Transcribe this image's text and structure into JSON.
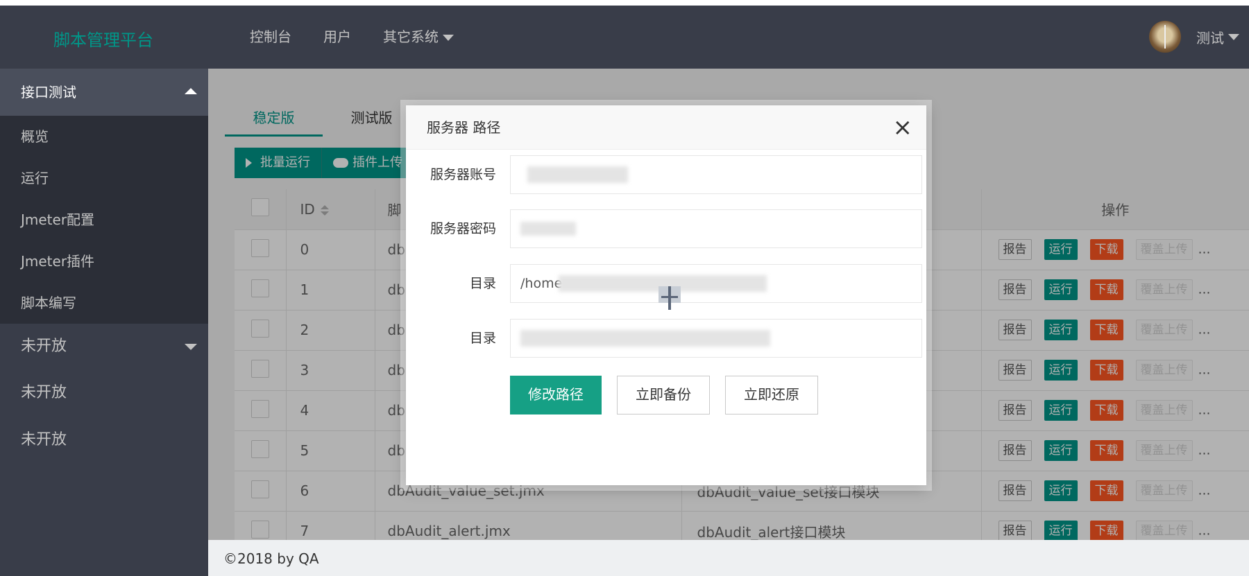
{
  "header": {
    "logo": "脚本管理平台",
    "nav": [
      "控制台",
      "用户",
      "其它系统"
    ],
    "user_name": "测试"
  },
  "sidebar": {
    "group_title": "接口测试",
    "items": [
      "概览",
      "运行",
      "Jmeter配置",
      "Jmeter插件",
      "脚本编写"
    ],
    "group2_title": "未开放",
    "plain_items": [
      "未开放",
      "未开放"
    ]
  },
  "tabs": [
    "稳定版",
    "测试版"
  ],
  "toolbar": {
    "batch_run": "批量运行",
    "plugin_upload": "插件上传"
  },
  "table": {
    "headers": {
      "id": "ID",
      "script": "脚",
      "ops": "操作"
    },
    "rows": [
      {
        "id": "0",
        "script": "db",
        "desc": ""
      },
      {
        "id": "1",
        "script": "db",
        "desc": ""
      },
      {
        "id": "2",
        "script": "db",
        "desc": ""
      },
      {
        "id": "3",
        "script": "db",
        "desc": ""
      },
      {
        "id": "4",
        "script": "db",
        "desc": ""
      },
      {
        "id": "5",
        "script": "db",
        "desc": ""
      },
      {
        "id": "6",
        "script": "dbAudit_value_set.jmx",
        "desc": "dbAudit_value_set接口模块"
      },
      {
        "id": "7",
        "script": "dbAudit_alert.jmx",
        "desc": "dbAudit_alert接口模块"
      }
    ],
    "ops": {
      "report": "报告",
      "run": "运行",
      "download": "下载",
      "overwrite": "覆盖上传",
      "more": "…"
    }
  },
  "footer": "©2018 by QA",
  "modal": {
    "title": "服务器  路径",
    "fields": [
      {
        "label": "服务器账号",
        "value": ""
      },
      {
        "label": "服务器密码",
        "value": ""
      },
      {
        "label": "目录",
        "value": "/home"
      },
      {
        "label": "目录",
        "value": ""
      }
    ],
    "buttons": {
      "primary": "修改路径",
      "backup": "立即备份",
      "restore": "立即还原"
    }
  },
  "colors": {
    "accent": "#009688",
    "danger": "#ff5722",
    "header_bg": "#393d49"
  }
}
